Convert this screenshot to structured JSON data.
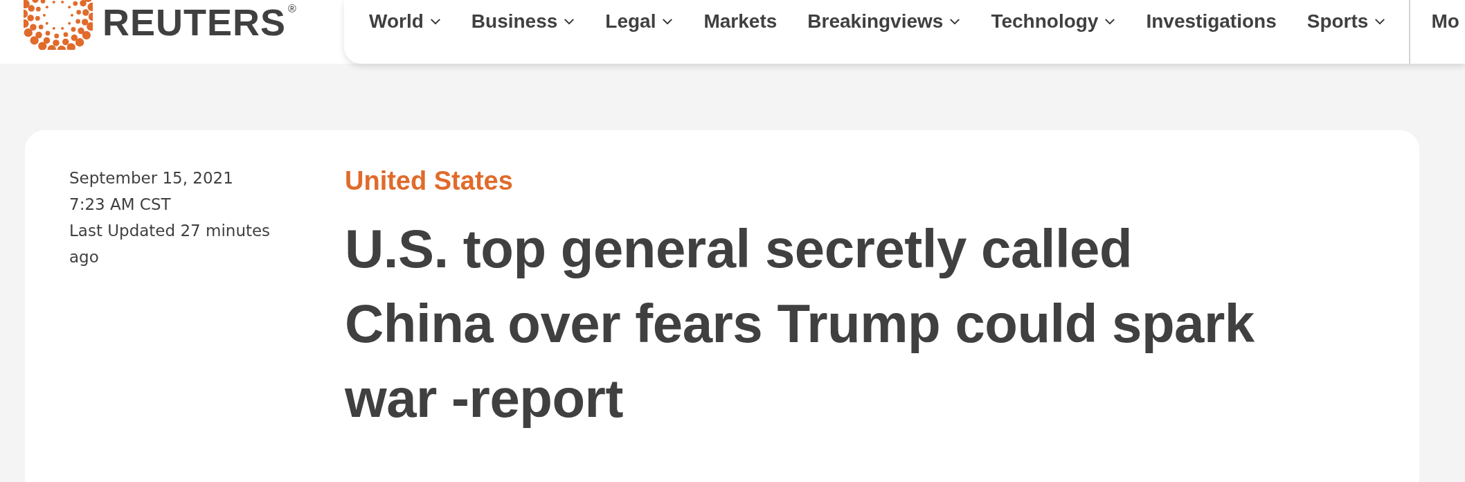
{
  "logo": {
    "text": "REUTERS",
    "mark": "®"
  },
  "nav": {
    "items": [
      {
        "label": "World",
        "has_menu": true
      },
      {
        "label": "Business",
        "has_menu": true
      },
      {
        "label": "Legal",
        "has_menu": true
      },
      {
        "label": "Markets",
        "has_menu": false
      },
      {
        "label": "Breakingviews",
        "has_menu": true
      },
      {
        "label": "Technology",
        "has_menu": true
      },
      {
        "label": "Investigations",
        "has_menu": false
      },
      {
        "label": "Sports",
        "has_menu": true
      }
    ],
    "overflow_item": "Mo"
  },
  "article": {
    "date": "September 15, 2021",
    "time": "7:23 AM CST",
    "updated": "Last Updated 27 minutes ago",
    "category": "United States",
    "headline": "U.S. top general secretly called China over fears Trump could spark war -report"
  }
}
